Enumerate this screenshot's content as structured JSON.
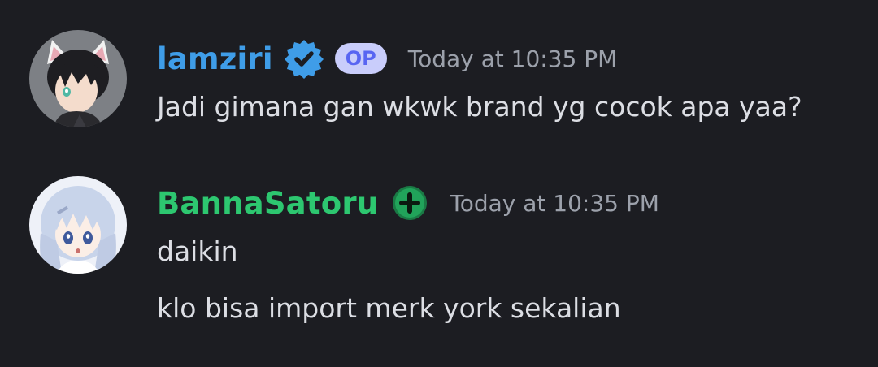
{
  "messages": [
    {
      "username": "lamziri",
      "username_color": "#3f9de8",
      "badges": [
        "verified-icon",
        "OP"
      ],
      "op_label": "OP",
      "timestamp": "Today at 10:35 PM",
      "lines": [
        "Jadi gimana gan wkwk brand yg cocok apa yaa?"
      ]
    },
    {
      "username": "BannaSatoru",
      "username_color": "#2dc770",
      "badges": [
        "plus-icon"
      ],
      "timestamp": "Today at 10:35 PM",
      "lines": [
        "daikin",
        "klo bisa import merk york sekalian"
      ]
    }
  ],
  "colors": {
    "background": "#1c1d22",
    "message_text": "#dcdee4",
    "timestamp": "#9ca1ab",
    "op_badge_bg": "#c9cdfb",
    "op_badge_text": "#5865f2"
  }
}
